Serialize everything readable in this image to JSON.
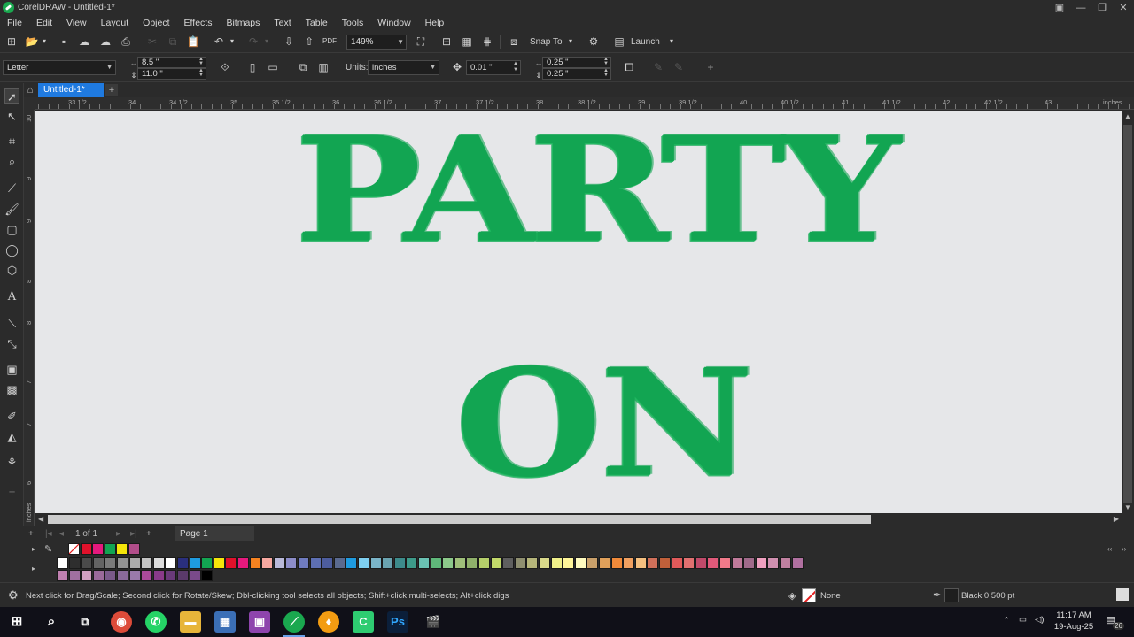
{
  "window": {
    "title": "CorelDRAW - Untitled-1*"
  },
  "menu": [
    "File",
    "Edit",
    "View",
    "Layout",
    "Object",
    "Effects",
    "Bitmaps",
    "Text",
    "Table",
    "Tools",
    "Window",
    "Help"
  ],
  "toolbar": {
    "zoom": "149%",
    "snap_label": "Snap To",
    "launch_label": "Launch"
  },
  "property_bar": {
    "page_size": "Letter",
    "width": "8.5 \"",
    "height": "11.0 \"",
    "units_label": "Units:",
    "units_value": "inches",
    "nudge": "0.01 \"",
    "dup_x": "0.25 \"",
    "dup_y": "0.25 \""
  },
  "document_tab": "Untitled-1*",
  "ruler": {
    "h_labels": [
      "33 1/2",
      "34",
      "34 1/2",
      "35",
      "35 1/2",
      "36",
      "36 1/2",
      "37",
      "37 1/2",
      "38",
      "38 1/2",
      "39",
      "39 1/2",
      "40",
      "40 1/2",
      "41",
      "41 1/2",
      "42",
      "42 1/2",
      "43"
    ],
    "h_unit": "inches",
    "v_labels": [
      "10",
      "9 1/2",
      "9",
      "8 1/2",
      "8",
      "7 1/2",
      "7",
      "6 1/2"
    ],
    "v_unit": "inches"
  },
  "canvas": {
    "line1": "PARTY",
    "line2": "ON",
    "art_color": "#12a552"
  },
  "page_nav": {
    "count": "1 of 1",
    "page_tab": "Page 1"
  },
  "palette": {
    "row1": [
      "#ffffff",
      "#e0112b",
      "#e5197d",
      "#12a552",
      "#f5e50a",
      "#b14d8a"
    ],
    "row2": [
      "#ffffff",
      "#2e2e2e",
      "#4a4a4a",
      "#636363",
      "#7a7a7a",
      "#939393",
      "#ababab",
      "#c3c3c3",
      "#dcdcdc",
      "#ffffff",
      "#2a2f7e",
      "#1e9be0",
      "#12a552",
      "#f5e50a",
      "#e0112b",
      "#e5197d",
      "#f58220",
      "#f7a8a0",
      "#b9b9d9",
      "#8d8dc9",
      "#6f7bbf",
      "#5d6fb3",
      "#4d5d9e",
      "#5a6a8f",
      "#1e9be0",
      "#7ecff0",
      "#7ab4c8",
      "#6aa3b0",
      "#3d8b8b",
      "#3d9b8a",
      "#6ac2b3",
      "#5fb87a",
      "#8cc98a",
      "#9fbf7a",
      "#8fb06a",
      "#b5cf6a",
      "#c2d96a",
      "#5f5f5f",
      "#8f8f70",
      "#b5b57a",
      "#d9d98a",
      "#f0f08a",
      "#fff69a",
      "#fffbc0",
      "#c9a06a",
      "#e0a05a",
      "#f08a3a",
      "#f0a060",
      "#f5c080",
      "#d0705a",
      "#c0603a",
      "#e05a5a",
      "#e07070",
      "#c04a6a",
      "#e05a7a",
      "#f07a8a",
      "#c07a9a",
      "#a06a8a",
      "#f0a0c0",
      "#d090b0",
      "#c080a0",
      "#b070a0"
    ],
    "row3": [
      "#c080b0",
      "#a070a0",
      "#d0a0c0",
      "#9a6a9a",
      "#7a5a8a",
      "#8a6a9a",
      "#9a7aaa",
      "#aa4a9a",
      "#8a3a8a",
      "#6a3a7a",
      "#5a3a6a",
      "#7a4a8a",
      "#000000"
    ]
  },
  "status": {
    "hint": "Next click for Drag/Scale; Second click for Rotate/Skew; Dbl-clicking tool selects all objects; Shift+click multi-selects; Alt+click digs",
    "fill": "None",
    "outline": "Black  0.500 pt"
  },
  "taskbar": {
    "time": "11:17 AM",
    "date": "19-Aug-25",
    "notifications": "26"
  }
}
